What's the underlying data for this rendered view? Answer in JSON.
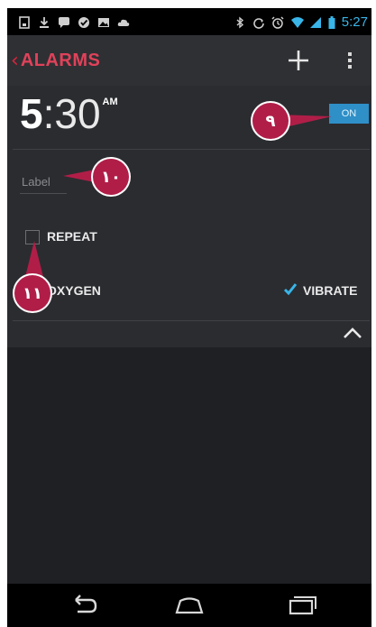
{
  "status_bar": {
    "time": "5:27",
    "left_icons": [
      "screenshot-icon",
      "download-icon",
      "chat-icon",
      "check-icon",
      "image-icon",
      "cloud-icon"
    ],
    "right_icons": [
      "bluetooth-icon",
      "sync-icon",
      "alarm-icon",
      "wifi-icon",
      "signal-icon",
      "battery-icon"
    ]
  },
  "action_bar": {
    "title": "ALARMS",
    "accent_color": "#e0425a"
  },
  "alarm": {
    "hour": "5",
    "minute": ":30",
    "ampm": "AM",
    "toggle_label": "ON",
    "toggle_color": "#2f8fc7",
    "label_placeholder": "Label",
    "repeat_label": "REPEAT",
    "repeat_checked": false,
    "ringtone_label": "OXYGEN",
    "vibrate_label": "VIBRATE",
    "vibrate_checked": true
  },
  "callouts": [
    {
      "number": "٩"
    },
    {
      "number": "١٠"
    },
    {
      "number": "١١"
    }
  ],
  "nav_bar": {
    "icons": [
      "back-icon",
      "home-icon",
      "recents-icon"
    ]
  }
}
